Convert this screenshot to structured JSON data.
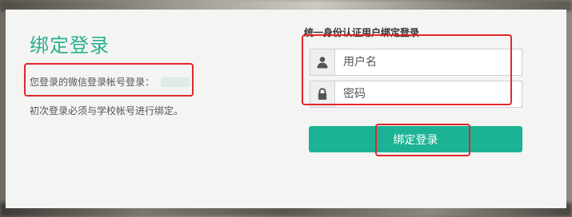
{
  "left": {
    "title": "绑定登录",
    "wechat_label": "您登录的微信登录帐号登录：",
    "note": "初次登录必须与学校帐号进行绑定。"
  },
  "form": {
    "title": "统一身份认证用户绑定登录",
    "username_placeholder": "用户名",
    "username_icon": "user-icon",
    "password_placeholder": "密码",
    "password_icon": "lock-icon",
    "submit_label": "绑定登录"
  },
  "colors": {
    "accent": "#1cb394",
    "title": "#2ab08f",
    "highlight": "#e0272b"
  }
}
